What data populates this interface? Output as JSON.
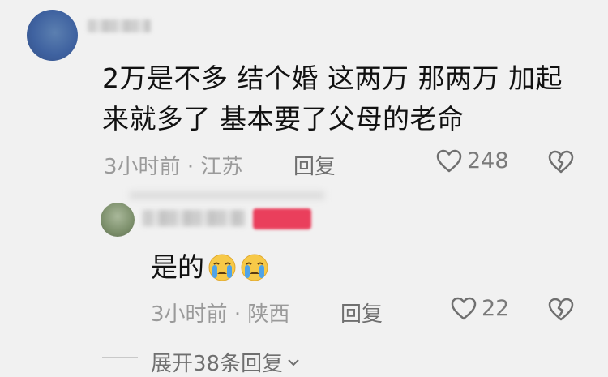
{
  "comment": {
    "text": "2万是不多 结个婚 这两万 那两万 加起来就多了 基本要了父母的老命",
    "time": "3小时前",
    "location": "江苏",
    "reply_label": "回复",
    "like_count": "248"
  },
  "reply": {
    "text": "是的",
    "emojis": [
      "crying-face",
      "crying-face"
    ],
    "time": "3小时前",
    "location": "陕西",
    "reply_label": "回复",
    "like_count": "22"
  },
  "expand_label": "展开38条回复",
  "icons": {
    "like": "heart-outline-icon",
    "dislike": "broken-heart-icon",
    "expand": "chevron-down-icon"
  },
  "colors": {
    "badge": "#ea3f5c",
    "meta_text": "#9a9a9a"
  }
}
